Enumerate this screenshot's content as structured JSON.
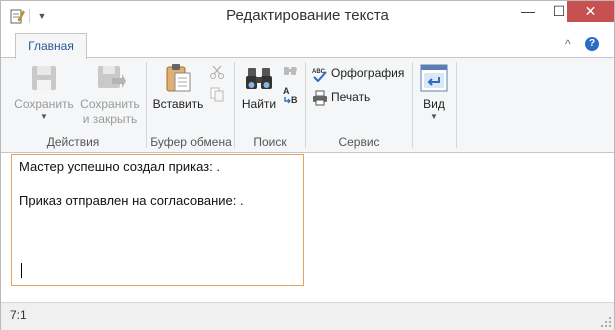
{
  "window": {
    "title": "Редактирование текста",
    "minimize_glyph": "—",
    "maximize_glyph": "☐",
    "close_glyph": "✕",
    "close_color": "#c75050"
  },
  "qat": {
    "dropdown_glyph": "▼"
  },
  "tabs": {
    "home_label": "Главная",
    "collapse_glyph": "^",
    "help_glyph": "?"
  },
  "ribbon": {
    "groups": {
      "actions": {
        "label": "Действия",
        "save": "Сохранить",
        "save_close_line1": "Сохранить",
        "save_close_line2": "и закрыть"
      },
      "clipboard": {
        "label": "Буфер обмена",
        "paste": "Вставить"
      },
      "search": {
        "label": "Поиск",
        "find": "Найти"
      },
      "service": {
        "label": "Сервис",
        "spelling": "Орфография",
        "print": "Печать"
      },
      "view": {
        "label": "Вид"
      }
    }
  },
  "editor": {
    "line1": "Мастер успешно создал приказ: .",
    "line2": "Приказ отправлен на согласование: ."
  },
  "status": {
    "position": "7:1"
  },
  "colors": {
    "accent": "#2b5797",
    "editor_border": "#e4a460"
  }
}
